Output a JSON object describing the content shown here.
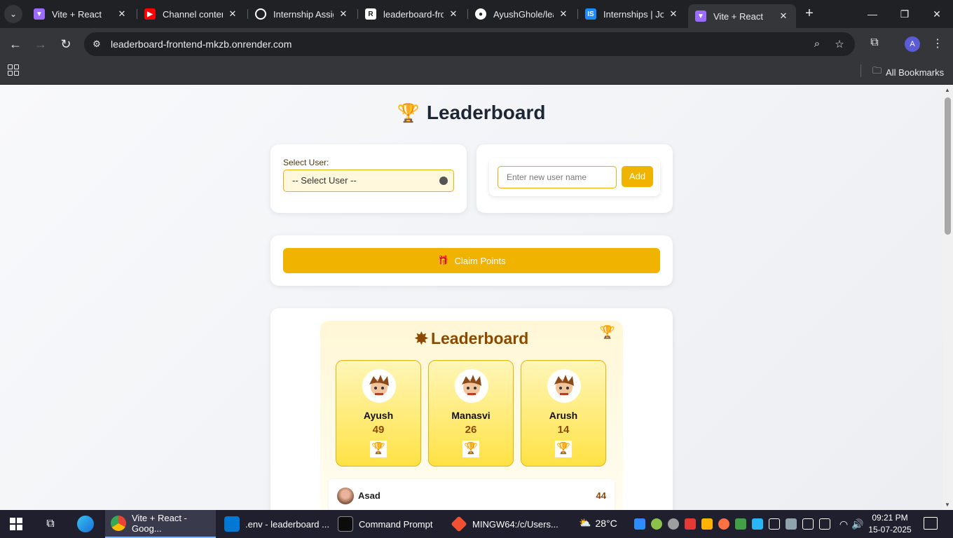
{
  "browser": {
    "tabs": [
      {
        "title": "Vite + React",
        "icon": "vite-icon",
        "color": "#9b6cff"
      },
      {
        "title": "Channel content",
        "icon": "youtube-icon",
        "color": "#ff0000"
      },
      {
        "title": "Internship Assign",
        "icon": "chatgpt-icon",
        "color": "#ffffff"
      },
      {
        "title": "leaderboard-fron",
        "icon": "render-icon",
        "color": "#ffffff"
      },
      {
        "title": "AyushGhole/lea",
        "icon": "github-icon",
        "color": "#ffffff"
      },
      {
        "title": "Internships | Job",
        "icon": "internshala-icon",
        "color": "#1a8cff"
      },
      {
        "title": "Vite + React",
        "icon": "vite-icon",
        "color": "#9b6cff"
      }
    ],
    "url": "leaderboard-frontend-mkzb.onrender.com",
    "all_bookmarks": "All Bookmarks",
    "profile_initial": "A"
  },
  "page": {
    "title": "Leaderboard",
    "select_label": "Select User:",
    "select_value": "-- Select User --",
    "new_user_placeholder": "Enter new user name",
    "add_label": "Add",
    "claim_label": "Claim Points",
    "leaderboard_heading": "Leaderboard",
    "top_three": [
      {
        "name": "Ayush",
        "points": "49"
      },
      {
        "name": "Manasvi",
        "points": "26"
      },
      {
        "name": "Arush",
        "points": "14"
      }
    ],
    "list": [
      {
        "name": "Asad",
        "points": "44"
      }
    ]
  },
  "taskbar": {
    "tasks": [
      {
        "label": "Vite + React - Goog...",
        "icon": "chrome-icon"
      },
      {
        "label": ".env - leaderboard ...",
        "icon": "vscode-icon"
      },
      {
        "label": "Command Prompt",
        "icon": "cmd-icon"
      },
      {
        "label": "MINGW64:/c/Users...",
        "icon": "git-bash-icon"
      }
    ],
    "temperature": "28°C",
    "time": "09:21 PM",
    "date": "15-07-2025"
  },
  "colors": {
    "accent": "#f0b400",
    "heading": "#8a4a00"
  }
}
